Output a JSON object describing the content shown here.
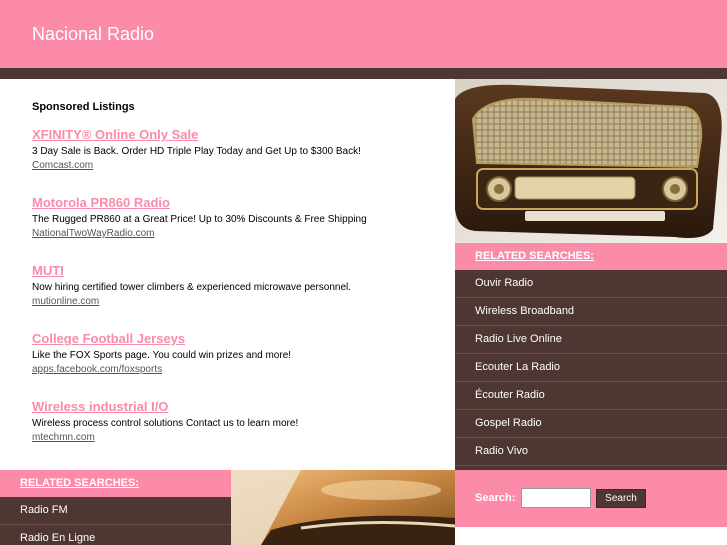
{
  "site": {
    "title": "Nacional Radio"
  },
  "sponsored": {
    "heading": "Sponsored Listings",
    "listings": [
      {
        "title": "XFINITY® Online Only Sale",
        "description": "3 Day Sale is Back. Order HD Triple Play Today and Get Up to $300 Back!",
        "url": "Comcast.com"
      },
      {
        "title": "Motorola PR860 Radio",
        "description": "The Rugged PR860 at a Great Price! Up to 30% Discounts & Free Shipping",
        "url": "NationalTwoWayRadio.com"
      },
      {
        "title": "MUTI",
        "description": "Now hiring certified tower climbers & experienced microwave personnel.",
        "url": "mutionline.com"
      },
      {
        "title": "College Football Jerseys",
        "description": "Like the FOX Sports page. You could win prizes and more!",
        "url": "apps.facebook.com/foxsports"
      },
      {
        "title": "Wireless industrial I/O",
        "description": "Wireless process control solutions Contact us to learn more!",
        "url": "mtechmn.com"
      }
    ]
  },
  "right_related": {
    "heading": "RELATED SEARCHES:",
    "items": [
      "Ouvir Radio",
      "Wireless Broadband",
      "Radio Live Online",
      "Ecouter La Radio",
      "Écouter Radio",
      "Gospel Radio",
      "Radio Vivo"
    ]
  },
  "bottom_related": {
    "heading": "RELATED SEARCHES:",
    "items": [
      "Radio FM",
      "Radio En Ligne"
    ]
  },
  "search": {
    "label": "Search:",
    "value": "",
    "button_label": "Search"
  },
  "colors": {
    "pink": "#fc8aa9",
    "brown": "#4e3733",
    "white": "#ffffff"
  },
  "images": {
    "header_photo": "vintage-radio-photo",
    "bottom_photo": "radio-closeup-photo"
  }
}
